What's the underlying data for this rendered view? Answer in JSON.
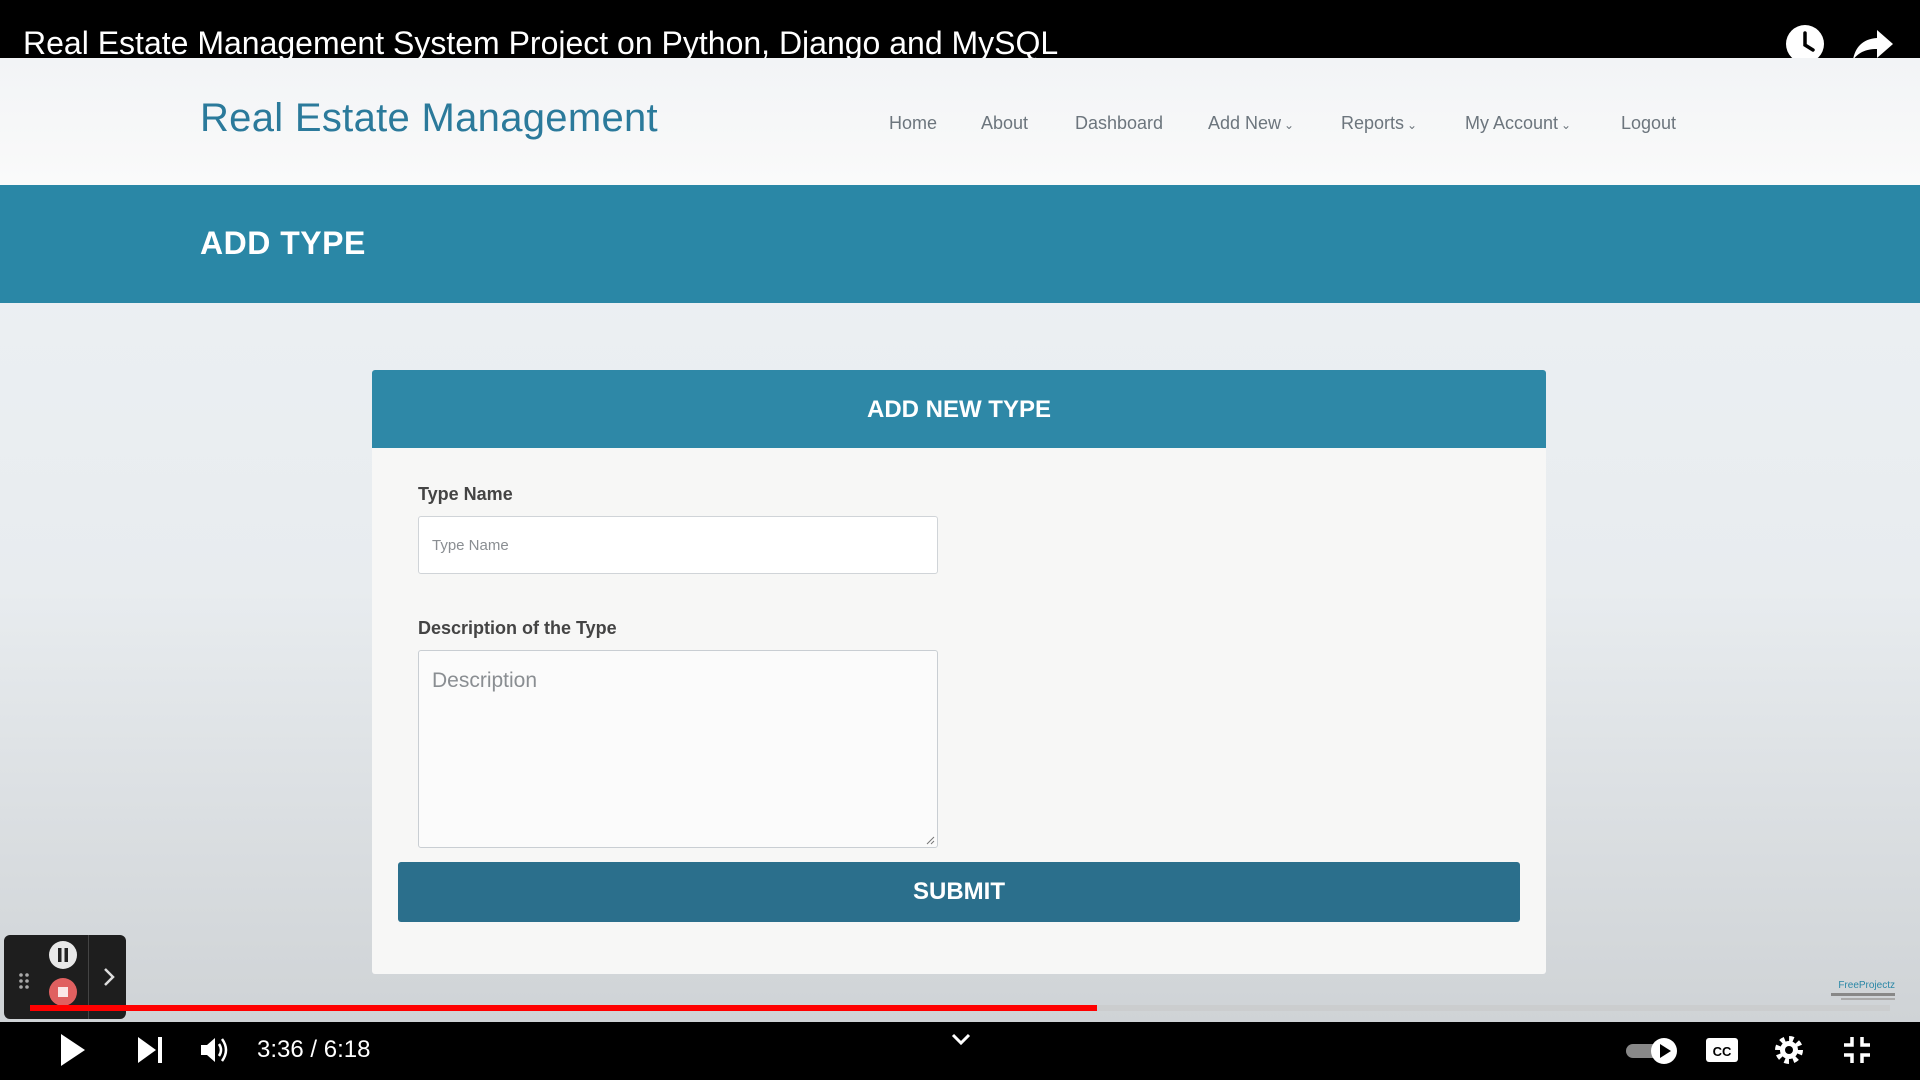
{
  "video": {
    "title": "Real Estate Management System Project on Python, Django and MySQL",
    "time_current": "3:36",
    "time_separator": "/",
    "time_total": "6:18",
    "progress_fraction": 0.5735
  },
  "site": {
    "logo": "Real Estate Management",
    "nav": [
      {
        "label": "Home",
        "dropdown": false
      },
      {
        "label": "About",
        "dropdown": false
      },
      {
        "label": "Dashboard",
        "dropdown": false
      },
      {
        "label": "Add New",
        "dropdown": true
      },
      {
        "label": "Reports",
        "dropdown": true
      },
      {
        "label": "My Account",
        "dropdown": true
      },
      {
        "label": "Logout",
        "dropdown": false
      }
    ]
  },
  "page": {
    "banner_title": "ADD TYPE",
    "card_title": "ADD NEW TYPE",
    "type_name_label": "Type Name",
    "type_name_placeholder": "Type Name",
    "description_label": "Description of the Type",
    "description_placeholder": "Description",
    "submit_label": "SUBMIT",
    "watermark_brand": "FreeProjectz"
  },
  "colors": {
    "accent": "#2a87a6",
    "submit": "#2b6f8c",
    "progress": "#ff0000"
  },
  "icons": [
    "watch-later-icon",
    "share-icon",
    "play-icon",
    "next-icon",
    "volume-icon",
    "chevron-down-icon",
    "autoplay-toggle-icon",
    "captions-icon",
    "settings-icon",
    "exit-fullscreen-icon"
  ]
}
